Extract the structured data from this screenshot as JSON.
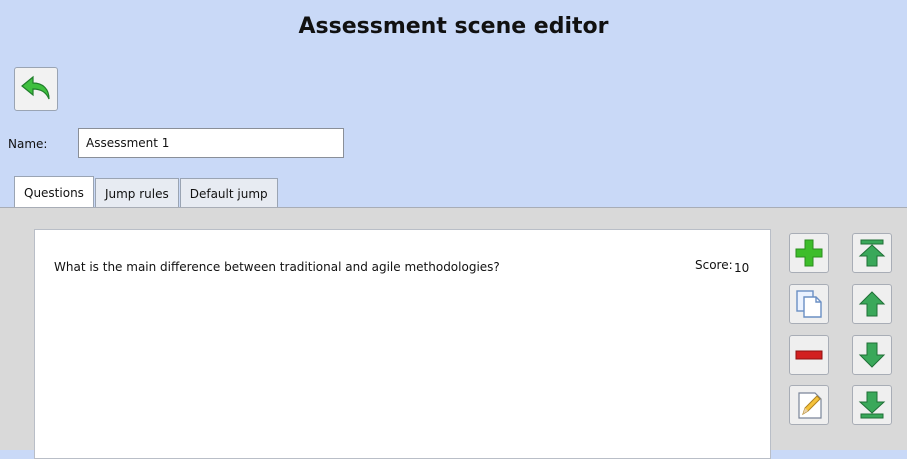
{
  "window": {
    "title": "Assessment scene editor"
  },
  "toolbar": {
    "back_icon": "undo-arrow-icon"
  },
  "name_field": {
    "label": "Name:",
    "value": "Assessment 1"
  },
  "tabs": [
    {
      "label": "Questions",
      "active": true
    },
    {
      "label": "Jump rules",
      "active": false
    },
    {
      "label": "Default jump",
      "active": false
    }
  ],
  "questions": [
    {
      "text": "What is the main difference between traditional and agile methodologies?",
      "score_label": "Score:",
      "score": "10"
    }
  ],
  "side_buttons": {
    "add": "plus-icon",
    "duplicate": "duplicate-icon",
    "delete": "minus-icon",
    "edit": "pencil-icon",
    "move_top": "move-to-top-icon",
    "move_up": "move-up-icon",
    "move_down": "move-down-icon",
    "move_bottom": "move-to-bottom-icon"
  },
  "colors": {
    "background": "#c9d9f7",
    "add_green": "#3dbd2a",
    "delete_red": "#d22020",
    "arrow_green": "#3aa85a"
  }
}
